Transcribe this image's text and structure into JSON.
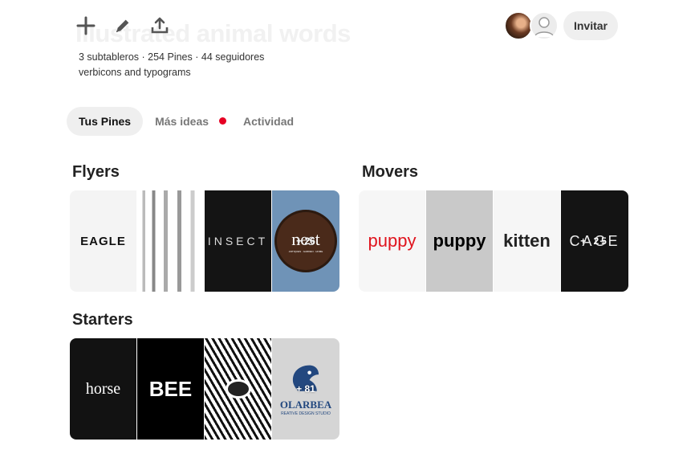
{
  "board": {
    "title": "Illustrated animal words",
    "stats": "3 subtableros · 254 Pines · 44 seguidores",
    "description": "verbicons and typograms"
  },
  "toolbar": {
    "icons": [
      "plus-icon",
      "pencil-icon",
      "share-icon"
    ]
  },
  "header": {
    "invite_label": "Invitar"
  },
  "tabs": [
    {
      "label": "Tus Pines",
      "active": true
    },
    {
      "label": "Más ideas",
      "badge": true
    },
    {
      "label": "Actividad"
    }
  ],
  "sections": [
    {
      "title": "Flyers",
      "count": "+ 26",
      "tiles": [
        "EAGLE",
        "",
        "INSECT",
        "nest",
        "ANTIQUES · GARDEN · HOME"
      ]
    },
    {
      "title": "Movers",
      "count": "+ 25",
      "tiles": [
        "puppy",
        "puppy",
        "kitten",
        "CAGE"
      ]
    },
    {
      "title": "Starters",
      "count": "+ 81",
      "tiles": [
        "horse",
        "BEE",
        "",
        "OLARBEA",
        "REATIVE DESIGN STUDIO"
      ]
    }
  ],
  "colors": {
    "accent_dot": "#e60023",
    "pill_bg": "#efefef"
  }
}
